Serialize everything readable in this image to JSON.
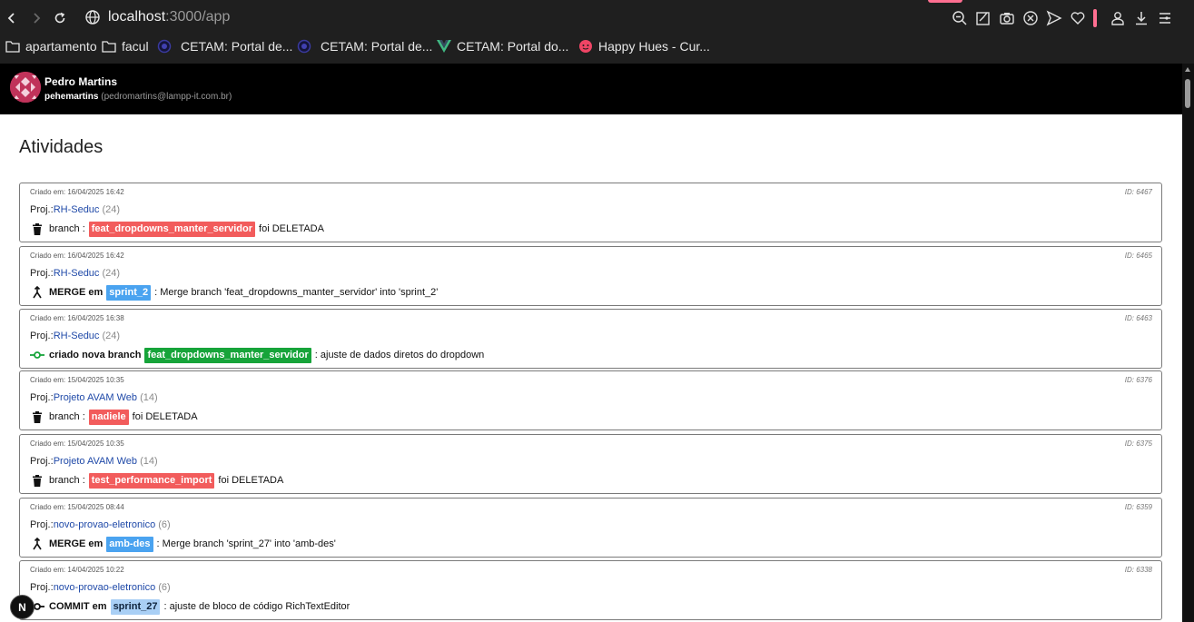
{
  "browser": {
    "url_host": "localhost",
    "url_path": ":3000/app",
    "bookmarks": [
      {
        "label": "apartamento",
        "icon": "folder-icon"
      },
      {
        "label": "facul",
        "icon": "folder-icon"
      },
      {
        "label": "CETAM: Portal de...",
        "icon": "cetam-icon"
      },
      {
        "label": "CETAM: Portal de...",
        "icon": "cetam-icon"
      },
      {
        "label": "CETAM: Portal do...",
        "icon": "vue-icon"
      },
      {
        "label": "Happy Hues - Cur...",
        "icon": "happy-hues-icon"
      }
    ]
  },
  "user": {
    "name": "Pedro Martins",
    "login": "pehemartins",
    "email": "(pedromartins@lampp-it.com.br)"
  },
  "page": {
    "title": "Atividades"
  },
  "labels": {
    "created_prefix": "Criado em: ",
    "id_prefix": "ID: ",
    "proj_prefix": "Proj.:"
  },
  "activities": [
    {
      "created": "16/04/2025 16:42",
      "id": "6467",
      "project": "RH-Seduc",
      "count": "(24)",
      "icon": "trash-icon",
      "action": "branch :",
      "tag": "feat_dropdowns_manter_servidor",
      "tag_color": "#f25c5c",
      "after": "foi DELETADA"
    },
    {
      "created": "16/04/2025 16:42",
      "id": "6465",
      "project": "RH-Seduc",
      "count": "(24)",
      "icon": "merge-icon",
      "action": "MERGE em",
      "tag": "sprint_2",
      "tag_color": "#4aa3f0",
      "after": ": Merge branch 'feat_dropdowns_manter_servidor' into 'sprint_2'"
    },
    {
      "created": "16/04/2025 16:38",
      "id": "6463",
      "project": "RH-Seduc",
      "count": "(24)",
      "icon": "branch-created-icon",
      "action": "criado nova branch",
      "tag": "feat_dropdowns_manter_servidor",
      "tag_color": "#17a43a",
      "after": ": ajuste de dados diretos do dropdown"
    },
    {
      "created": "15/04/2025 10:35",
      "id": "6376",
      "project": "Projeto AVAM Web",
      "count": "(14)",
      "icon": "trash-icon",
      "action": "branch :",
      "tag": "nadiele",
      "tag_color": "#f25c5c",
      "after": "foi DELETADA"
    },
    {
      "created": "15/04/2025 10:35",
      "id": "6375",
      "project": "Projeto AVAM Web",
      "count": "(14)",
      "icon": "trash-icon",
      "action": "branch :",
      "tag": "test_performance_import",
      "tag_color": "#f25c5c",
      "after": "foi DELETADA"
    },
    {
      "created": "15/04/2025 08:44",
      "id": "6359",
      "project": "novo-provao-eletronico",
      "count": "(6)",
      "icon": "merge-icon",
      "action": "MERGE em",
      "tag": "amb-des",
      "tag_color": "#4aa3f0",
      "after": ": Merge branch 'sprint_27' into 'amb-des'"
    },
    {
      "created": "14/04/2025 10:22",
      "id": "6338",
      "project": "novo-provao-eletronico",
      "count": "(6)",
      "icon": "commit-icon",
      "action": "COMMIT em",
      "tag": "sprint_27",
      "tag_color": "#a9cff5",
      "after": ": ajuste de bloco de código RichTextEditor"
    }
  ],
  "badge": {
    "label": "N"
  }
}
